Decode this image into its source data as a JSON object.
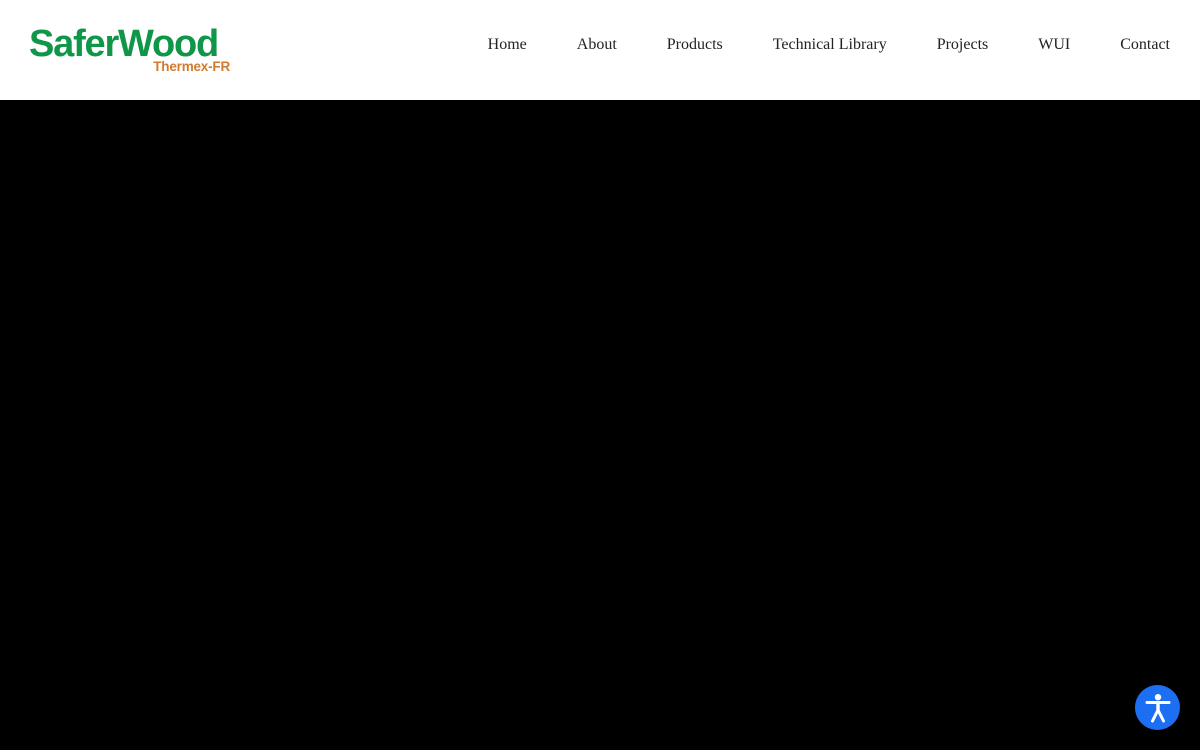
{
  "brand": {
    "name": "SaferWood",
    "tagline": "Thermex-FR",
    "colors": {
      "primary_green": "#0f9648",
      "accent_orange": "#d27b2e"
    }
  },
  "nav": {
    "items": [
      {
        "label": "Home"
      },
      {
        "label": "About"
      },
      {
        "label": "Products"
      },
      {
        "label": "Technical Library"
      },
      {
        "label": "Projects"
      },
      {
        "label": "WUI"
      },
      {
        "label": "Contact"
      }
    ]
  },
  "hero": {
    "background": "#000000"
  },
  "accessibility_widget": {
    "icon": "accessibility-icon",
    "color": "#1c6ef2"
  }
}
